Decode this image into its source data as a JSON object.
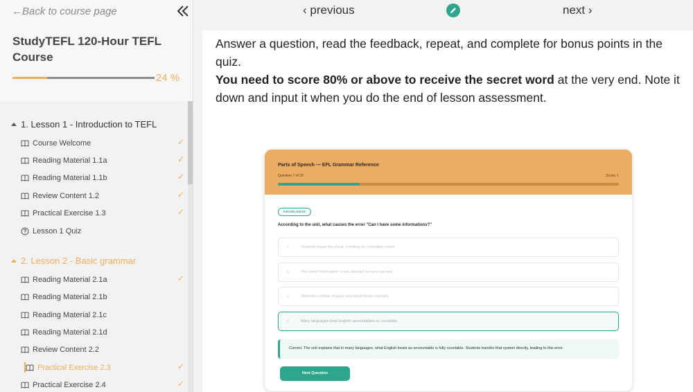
{
  "sidebar": {
    "back_label": "←Back to course page",
    "course_title": "StudyTEFL 120-Hour TEFL Course",
    "progress_percent": 24,
    "progress_label": "24 %",
    "lessons": [
      {
        "title": "1. Lesson 1 - Introduction to TEFL",
        "items": [
          {
            "label": "Course Welcome",
            "icon": "book-icon",
            "check": "✓"
          },
          {
            "label": "Reading Material 1.1a",
            "icon": "book-icon",
            "check": "✓"
          },
          {
            "label": "Reading Material 1.1b",
            "icon": "book-icon",
            "check": "✓"
          },
          {
            "label": "Review Content 1.2",
            "icon": "book-icon",
            "check": "✓"
          },
          {
            "label": "Practical Exercise 1.3",
            "icon": "book-icon",
            "check": "✓"
          },
          {
            "label": "Lesson 1 Quiz",
            "icon": "question-circle-icon",
            "check": ""
          }
        ]
      },
      {
        "title": "2. Lesson 2 - Basic grammar",
        "items": [
          {
            "label": "Reading Material 2.1a",
            "icon": "book-icon",
            "check": "✓"
          },
          {
            "label": "Reading Material 2.1b",
            "icon": "book-icon",
            "check": ""
          },
          {
            "label": "Reading Material 2.1c",
            "icon": "book-icon",
            "check": ""
          },
          {
            "label": "Reading Material 2.1d",
            "icon": "book-icon",
            "check": ""
          },
          {
            "label": "Review Content 2.2",
            "icon": "book-icon",
            "check": ""
          },
          {
            "label": "Practical Exercise 2.3",
            "icon": "book-icon",
            "check": "✓"
          },
          {
            "label": "Practical Exercise 2.4",
            "icon": "book-icon",
            "check": "✓"
          }
        ]
      }
    ]
  },
  "topnav": {
    "previous_label": "‹ previous",
    "next_label": "next ›"
  },
  "main": {
    "intro": "Answer a question, read the feedback, repeat, and complete for bonus points in the quiz.",
    "bold_text": "You need to score 80% or above to receive the secret word",
    "rest_text": " at the very end. Note it down and input it when you do the end of lesson assessment."
  },
  "quiz": {
    "title": "Parts of Speech — EFL Grammar Reference",
    "question_counter": "Question 7 of 29",
    "score": "Score: 1",
    "progress_fraction": 0.24,
    "tag": "KNOWLEDGE",
    "question": "According to the unit, what causes the error \"Can I have some informations?\"",
    "options": [
      {
        "letter": "A",
        "text": "Students forget the plural -s ending on countable nouns"
      },
      {
        "letter": "B",
        "text": "The word \"information\" is too abstract for new learners"
      },
      {
        "letter": "C",
        "text": "Students confuse singular and plural forms regularly"
      },
      {
        "letter": "D",
        "text": "Many languages treat English uncountables as countable"
      }
    ],
    "correct_option": "D",
    "feedback": "Correct. The unit explains that in many languages, what English treats as uncountable is fully countable. Students transfer that system directly, leading to this error.",
    "next_button": "Next Question"
  },
  "colors": {
    "accent_orange": "#f0ad5a",
    "teal": "#2ea58d",
    "card_header": "#ecac63"
  }
}
